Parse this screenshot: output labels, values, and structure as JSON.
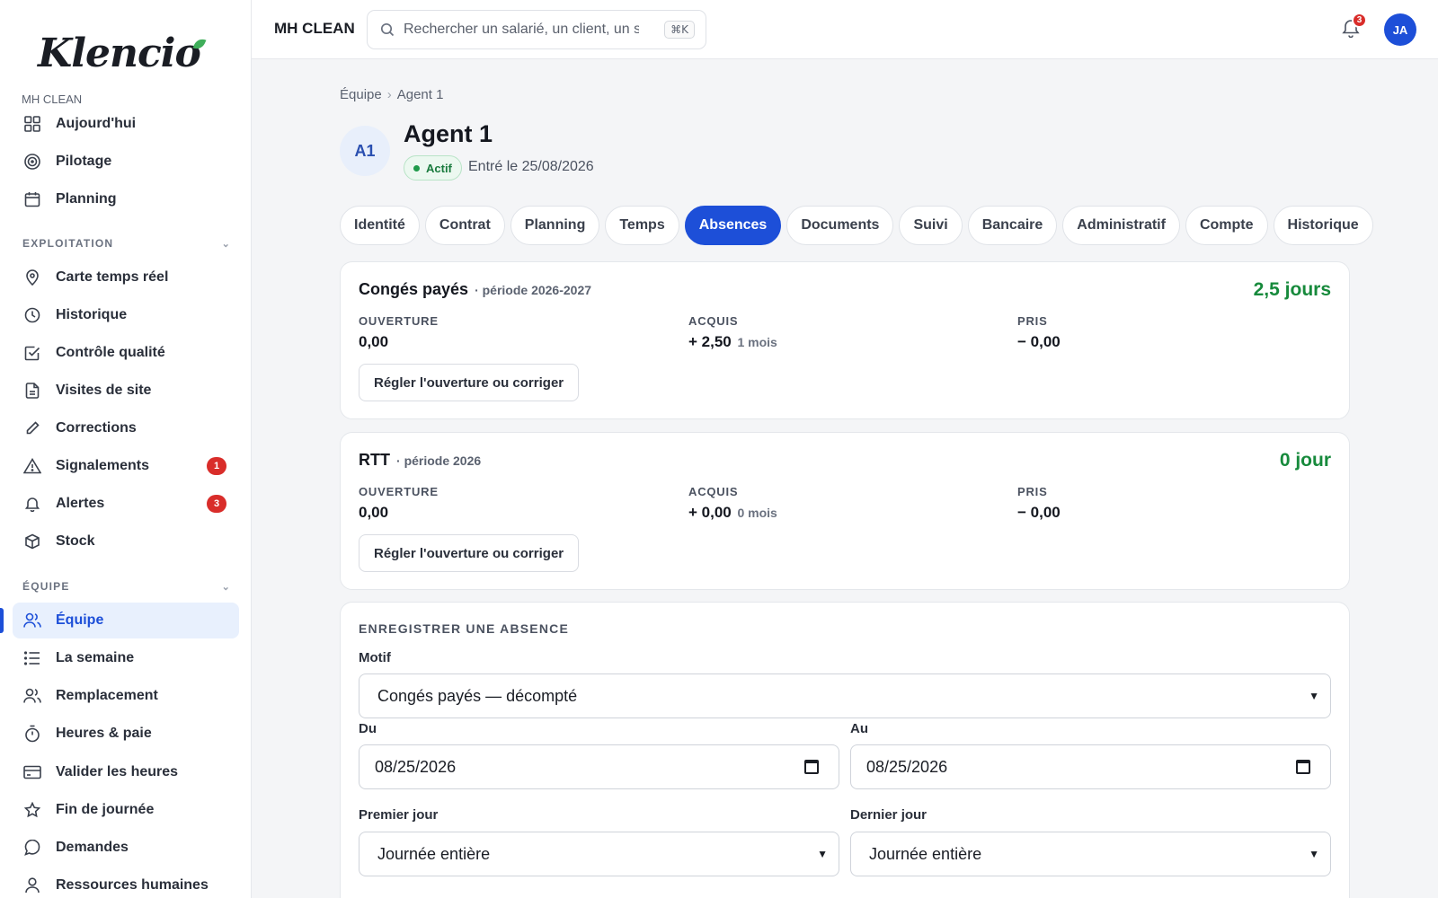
{
  "brand": {
    "logo": "Klencio"
  },
  "org": {
    "name": "MH CLEAN"
  },
  "sidebar": {
    "top_items": [
      {
        "label": "Aujourd'hui",
        "icon": "grid-icon"
      },
      {
        "label": "Pilotage",
        "icon": "target-icon"
      },
      {
        "label": "Planning",
        "icon": "calendar-icon"
      }
    ],
    "sections": [
      {
        "title": "EXPLOITATION",
        "items": [
          {
            "label": "Carte temps réel",
            "icon": "map-pin-icon"
          },
          {
            "label": "Historique",
            "icon": "clock-icon"
          },
          {
            "label": "Contrôle qualité",
            "icon": "check-square-icon"
          },
          {
            "label": "Visites de site",
            "icon": "document-icon"
          },
          {
            "label": "Corrections",
            "icon": "pen-icon"
          },
          {
            "label": "Signalements",
            "icon": "warning-icon",
            "badge": "1"
          },
          {
            "label": "Alertes",
            "icon": "bell-icon",
            "badge": "3"
          },
          {
            "label": "Stock",
            "icon": "box-icon"
          }
        ]
      },
      {
        "title": "ÉQUIPE",
        "items": [
          {
            "label": "Équipe",
            "icon": "users-icon",
            "active": true
          },
          {
            "label": "La semaine",
            "icon": "list-icon"
          },
          {
            "label": "Remplacement",
            "icon": "users-icon"
          },
          {
            "label": "Heures & paie",
            "icon": "stopwatch-icon"
          },
          {
            "label": "Valider les heures",
            "icon": "card-icon"
          },
          {
            "label": "Fin de journée",
            "icon": "star-icon"
          },
          {
            "label": "Demandes",
            "icon": "chat-icon"
          },
          {
            "label": "Ressources humaines",
            "icon": "user-icon"
          }
        ]
      }
    ]
  },
  "topbar": {
    "company": "MH CLEAN",
    "search_placeholder": "Rechercher un salarié, un client, un site",
    "shortcut": "⌘K",
    "notifications": "3",
    "user_initials": "JA"
  },
  "breadcrumb": {
    "parent": "Équipe",
    "current": "Agent 1"
  },
  "agent": {
    "initials": "A1",
    "name": "Agent 1",
    "status": "Actif",
    "entry": "Entré le 25/08/2026"
  },
  "tabs": [
    "Identité",
    "Contrat",
    "Planning",
    "Temps",
    "Absences",
    "Documents",
    "Suivi",
    "Bancaire",
    "Administratif",
    "Compte",
    "Historique"
  ],
  "active_tab": "Absences",
  "balances": [
    {
      "title": "Congés payés",
      "period": "· période 2026-2027",
      "total": "2,5 jours",
      "opening_label": "OUVERTURE",
      "opening": "0,00",
      "acquired_label": "ACQUIS",
      "acquired": "+ 2,50",
      "acquired_sub": "1 mois",
      "taken_label": "PRIS",
      "taken": "− 0,00",
      "button": "Régler l'ouverture ou corriger"
    },
    {
      "title": "RTT",
      "period": "· période 2026",
      "total": "0 jour",
      "opening_label": "OUVERTURE",
      "opening": "0,00",
      "acquired_label": "ACQUIS",
      "acquired": "+ 0,00",
      "acquired_sub": "0 mois",
      "taken_label": "PRIS",
      "taken": "− 0,00",
      "button": "Régler l'ouverture ou corriger"
    }
  ],
  "absence_form": {
    "heading": "ENREGISTRER UNE ABSENCE",
    "motif_label": "Motif",
    "motif_value": "Congés payés — décompté",
    "from_label": "Du",
    "from_value": "08/25/2026",
    "to_label": "Au",
    "to_value": "08/25/2026",
    "first_day_label": "Premier jour",
    "first_day_value": "Journée entière",
    "last_day_label": "Dernier jour",
    "last_day_value": "Journée entière"
  },
  "colors": {
    "accent": "#1d4fd8",
    "success": "#178a3c",
    "badge": "#d92d2a"
  }
}
